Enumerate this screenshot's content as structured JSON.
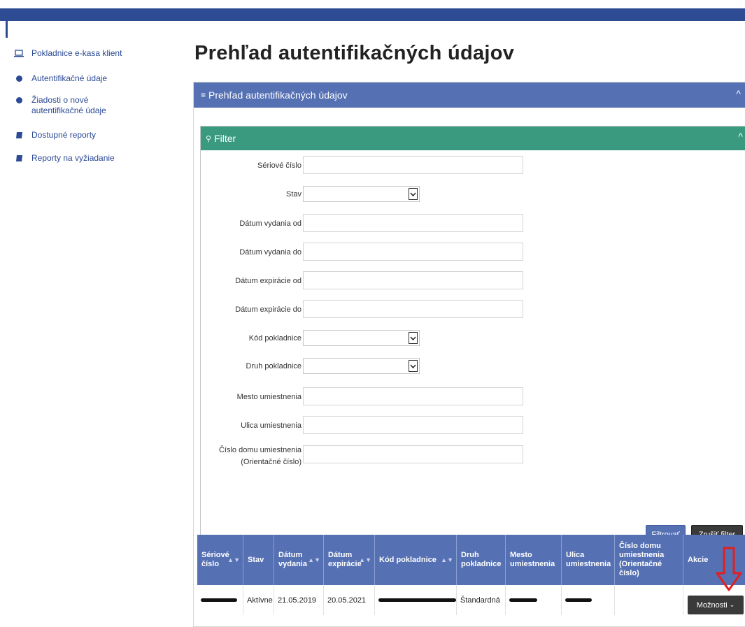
{
  "sidebar": {
    "items": [
      {
        "label": "Pokladnice e-kasa klient",
        "icon": "laptop-icon"
      },
      {
        "label": "Autentifikačné údaje",
        "icon": "gear-icon"
      },
      {
        "label": "Žiadosti o nové",
        "label2": "autentifikačné údaje",
        "icon": "gear-icon"
      },
      {
        "label": "Dostupné reporty",
        "icon": "book-icon"
      },
      {
        "label": "Reporty na vyžiadanie",
        "icon": "book-icon"
      }
    ]
  },
  "page": {
    "title": "Prehľad autentifikačných údajov"
  },
  "panel": {
    "title": "Prehľad autentifikačných údajov",
    "icon": "list-icon"
  },
  "filter": {
    "title": "Filter",
    "icon": "search-icon",
    "fields": {
      "serial": "Sériové číslo",
      "state": "Stav",
      "issue_from": "Dátum vydania od",
      "issue_to": "Dátum vydania do",
      "exp_from": "Dátum expirácie od",
      "exp_to": "Dátum expirácie do",
      "cash_code": "Kód pokladnice",
      "cash_type": "Druh pokladnice",
      "city": "Mesto umiestnenia",
      "street": "Ulica umiestnenia",
      "house_1": "Číslo domu umiestnenia",
      "house_2": "(Orientačné číslo)"
    },
    "values": {
      "serial": "",
      "state": "",
      "issue_from": "",
      "issue_to": "",
      "exp_from": "",
      "exp_to": "",
      "cash_code": "",
      "cash_type": "",
      "city": "",
      "street": "",
      "house": ""
    },
    "buttons": {
      "apply": "Filtrovať",
      "clear": "Zrušiť filter"
    }
  },
  "table": {
    "headers": {
      "serial_1": "Sériové",
      "serial_2": "číslo",
      "state": "Stav",
      "issue_1": "Dátum",
      "issue_2": "vydania",
      "exp_1": "Dátum",
      "exp_2": "expirácie",
      "code": "Kód pokladnice",
      "type_1": "Druh",
      "type_2": "pokladnice",
      "city_1": "Mesto",
      "city_2": "umiestnenia",
      "street_1": "Ulica",
      "street_2": "umiestnenia",
      "house_1": "Číslo domu",
      "house_2": "umiestnenia",
      "house_3": "(Orientačné",
      "house_4": "číslo)",
      "actions": "Akcie"
    },
    "rows": [
      {
        "state": "Aktívne",
        "issued": "21.05.2019",
        "expires": "20.05.2021",
        "type": "Štandardná",
        "house": "",
        "action_label": "Možnosti"
      }
    ]
  },
  "colors": {
    "brand_blue": "#2e4c93",
    "panel_blue": "#5570b3",
    "filter_green": "#3a9a80",
    "dark_button": "#3a3a3a",
    "annotation_red": "#e02020"
  }
}
